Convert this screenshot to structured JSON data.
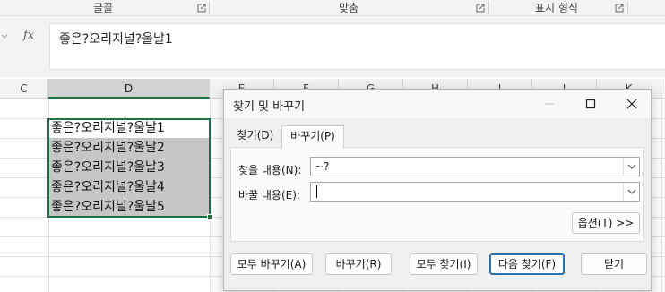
{
  "ribbon": {
    "groups": [
      {
        "label": "글꼴"
      },
      {
        "label": "맞춤"
      },
      {
        "label": "표시 형식"
      }
    ]
  },
  "formula_bar": {
    "fx_label": "fx",
    "content": "좋은?오리지널?울날1"
  },
  "columns": [
    "C",
    "D",
    "E",
    "F",
    "G",
    "H",
    "I",
    "J",
    "K"
  ],
  "selected_column": "D",
  "cells": [
    "좋은?오리지널?울날1",
    "좋은?오리지널?울날2",
    "좋은?오리지널?울날3",
    "좋은?오리지널?울날4",
    "좋은?오리지널?울날5"
  ],
  "dialog": {
    "title": "찾기 및 바꾸기",
    "tabs": [
      {
        "label": "찾기(D)",
        "active": false
      },
      {
        "label": "바꾸기(P)",
        "active": true
      }
    ],
    "find_label": "찾을 내용(N):",
    "find_value": "~?",
    "replace_label": "바꿀 내용(E):",
    "replace_value": "",
    "options_button": "옵션(T) >>",
    "buttons": {
      "replace_all": "모두 바꾸기(A)",
      "replace": "바꾸기(R)",
      "find_all": "모두 찾기(I)",
      "find_next": "다음 찾기(F)",
      "close": "닫기"
    }
  },
  "colors": {
    "accent_green": "#207245",
    "selection_fill": "#c6c6c6",
    "default_button_border": "#2b6fb5"
  }
}
